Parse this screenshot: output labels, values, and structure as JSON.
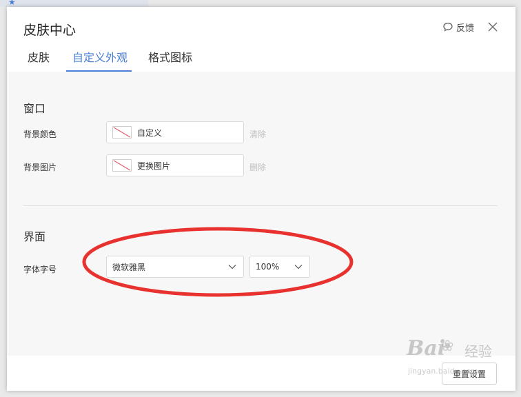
{
  "dialog": {
    "title": "皮肤中心",
    "feedback_label": "反馈"
  },
  "tabs": [
    {
      "label": "皮肤",
      "active": false
    },
    {
      "label": "自定义外观",
      "active": true
    },
    {
      "label": "格式图标",
      "active": false
    }
  ],
  "window_section": {
    "title": "窗口",
    "background_color": {
      "label": "背景颜色",
      "value": "自定义",
      "action": "清除"
    },
    "background_image": {
      "label": "背景图片",
      "value": "更换图片",
      "action": "删除"
    }
  },
  "interface_section": {
    "title": "界面",
    "font_label": "字体字号",
    "font_family_value": "微软雅黑",
    "font_size_value": "100%"
  },
  "footer": {
    "reset_label": "重置设置"
  },
  "watermark": {
    "logo": "Bai",
    "text": "经验",
    "url": "jingyan.baidu.com"
  },
  "colors": {
    "accent": "#4a7fd6",
    "annotation_red": "#e8322f",
    "swatch_slash": "#e05a6a"
  }
}
